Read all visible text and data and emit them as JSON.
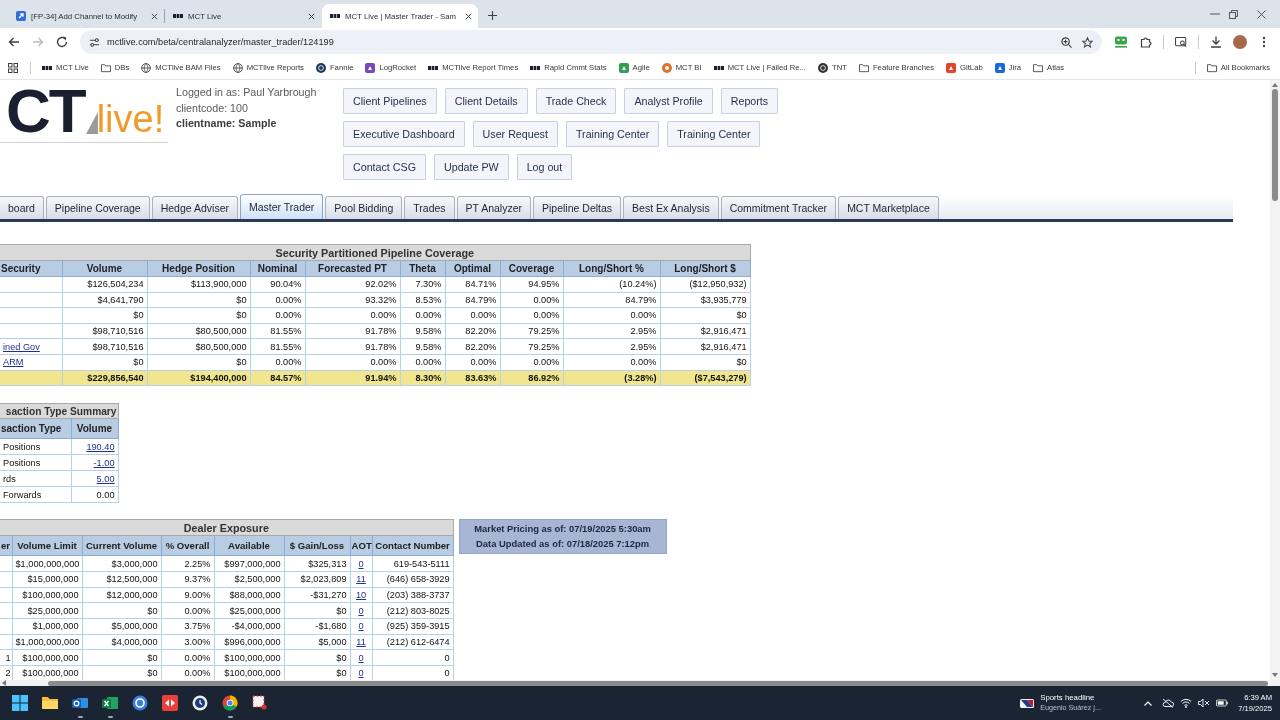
{
  "browser": {
    "tabs": [
      {
        "title": "[FP-34] Add Channel to Modify",
        "selected": false,
        "kind": "tracker"
      },
      {
        "title": "MCT Live",
        "selected": false,
        "kind": "site"
      },
      {
        "title": "MCT Live | Master Trader - Sam",
        "selected": true,
        "kind": "site"
      }
    ],
    "navigation": {
      "back_disabled": false,
      "forward_disabled": true
    },
    "address": "mctlive.com/beta/centralanalyzer/master_trader/124199",
    "bookmarks": [
      {
        "label": "MCT Live",
        "kind": "site"
      },
      {
        "label": "DBs",
        "kind": "folder"
      },
      {
        "label": "MCTlive BAM Files",
        "kind": "globe"
      },
      {
        "label": "MCTlive Reports",
        "kind": "globe"
      },
      {
        "label": "Fannie",
        "kind": "dot",
        "color": "#1e3a5f"
      },
      {
        "label": "LogRocket",
        "kind": "tile",
        "color": "#764abc"
      },
      {
        "label": "MCTlive Report Times",
        "kind": "site"
      },
      {
        "label": "Rapid Cmmt Stats",
        "kind": "site"
      },
      {
        "label": "Agile",
        "kind": "tile",
        "color": "#2e9e4f"
      },
      {
        "label": "MCT BI",
        "kind": "ring",
        "color": "#e0702a"
      },
      {
        "label": "MCT Live | Failed Re...",
        "kind": "site"
      },
      {
        "label": "TNT",
        "kind": "dot",
        "color": "#333333"
      },
      {
        "label": "Feature Branches",
        "kind": "folder"
      },
      {
        "label": "GitLab",
        "kind": "tile",
        "color": "#e24329"
      },
      {
        "label": "Jira",
        "kind": "tile",
        "color": "#1868db"
      },
      {
        "label": "Atlas",
        "kind": "folder"
      }
    ],
    "all_bookmarks": "All Bookmarks"
  },
  "page": {
    "logo": {
      "mark": "CT",
      "word": "live!"
    },
    "session": {
      "logged_in_as": "Logged in as: Paul Yarbrough",
      "clientcode": "clientcode: 100",
      "clientname": "clientname: Sample"
    },
    "menu_rows": [
      [
        "Client Pipelines",
        "Client Details",
        "Trade Check",
        "Analyst Profile",
        "Reports"
      ],
      [
        "Executive Dashboard",
        "User Request",
        "Training Center",
        "Training Center"
      ],
      [
        "Contact CSG",
        "Update PW",
        "Log out"
      ]
    ],
    "nav_tabs": [
      {
        "label": "board",
        "selected": false
      },
      {
        "label": "Pipeline Coverage",
        "selected": false
      },
      {
        "label": "Hedge Adviser",
        "selected": false
      },
      {
        "label": "Master Trader",
        "selected": true
      },
      {
        "label": "Pool Bidding",
        "selected": false
      },
      {
        "label": "Trades",
        "selected": false
      },
      {
        "label": "PT Analyzer",
        "selected": false
      },
      {
        "label": "Pipeline Deltas",
        "selected": false
      },
      {
        "label": "Best Ex Analysis",
        "selected": false
      },
      {
        "label": "Commitment Tracker",
        "selected": false
      },
      {
        "label": "MCT Marketplace",
        "selected": false
      }
    ],
    "security_coverage": {
      "title": "Security Partitioned Pipeline Coverage",
      "columns": [
        "Security",
        "Volume",
        "Hedge Position",
        "Nominal",
        "Forecasted PT",
        "Theta",
        "Optimal",
        "Coverage",
        "Long/Short %",
        "Long/Short $"
      ],
      "rows": [
        {
          "values": [
            "$126,504,234",
            "$113,900,000",
            "90.04%",
            "92.02%",
            "7.30%",
            "84.71%",
            "94.95%",
            "(10.24%)",
            "($12,950,932)"
          ]
        },
        {
          "values": [
            "$4,641,790",
            "$0",
            "0.00%",
            "93.32%",
            "8.53%",
            "84.79%",
            "0.00%",
            "84.79%",
            "$3,935,779"
          ]
        },
        {
          "values": [
            "$0",
            "$0",
            "0.00%",
            "0.00%",
            "0.00%",
            "0.00%",
            "0.00%",
            "0.00%",
            "$0"
          ]
        },
        {
          "values": [
            "$98,710,516",
            "$80,500,000",
            "81.55%",
            "91.78%",
            "9.58%",
            "82.20%",
            "79.25%",
            "2.95%",
            "$2,916,471"
          ]
        },
        {
          "security": "ined Gov",
          "link": true,
          "values": [
            "$98,710,516",
            "$80,500,000",
            "81.55%",
            "91.78%",
            "9.58%",
            "82.20%",
            "79.25%",
            "2.95%",
            "$2,916,471"
          ]
        },
        {
          "security": "ARM",
          "link": true,
          "values": [
            "$0",
            "$0",
            "0.00%",
            "0.00%",
            "0.00%",
            "0.00%",
            "0.00%",
            "0.00%",
            "$0"
          ]
        }
      ],
      "total": {
        "values": [
          "$229,856,540",
          "$194,400,000",
          "84.57%",
          "91.94%",
          "8.30%",
          "83.63%",
          "86.92%",
          "(3.28%)",
          "($7,543,279)"
        ]
      }
    },
    "transaction_summary": {
      "title": "saction Type Summary",
      "columns": [
        "saction Type",
        "Volume"
      ],
      "rows": [
        {
          "type": "Positions",
          "volume": "190.40",
          "link": true
        },
        {
          "type": "Positions",
          "volume": "-1.00",
          "link": true
        },
        {
          "type": "rds",
          "volume": "5.00",
          "link": true
        },
        {
          "type": "Forwards",
          "volume": "0.00",
          "link": false
        }
      ]
    },
    "dealer_exposure": {
      "title": "Dealer Exposure",
      "columns": [
        {
          "label": "er",
          "link": false
        },
        {
          "label": "Volume Limit",
          "link": false
        },
        {
          "label": "Current Volume",
          "link": false
        },
        {
          "label": "% Overall",
          "link": false
        },
        {
          "label": "Available",
          "link": false
        },
        {
          "label": "$ Gain/Loss",
          "link": false
        },
        {
          "label": "AOT",
          "link": true
        },
        {
          "label": "Contact Number",
          "link": false
        }
      ],
      "rows": [
        {
          "values": [
            "$1,000,000,000",
            "$3,000,000",
            "2.25%",
            "$997,000,000",
            "$325,313",
            "0",
            "619-543-5111"
          ]
        },
        {
          "values": [
            "$15,000,000",
            "$12,500,000",
            "9.37%",
            "$2,500,000",
            "$2,023,809",
            "11",
            "(646) 658-3929"
          ]
        },
        {
          "values": [
            "$100,000,000",
            "$12,000,000",
            "9.00%",
            "$88,000,000",
            "-$31,270",
            "10",
            "(203) 388-3737"
          ]
        },
        {
          "values": [
            "$25,000,000",
            "$0",
            "0.00%",
            "$25,000,000",
            "$0",
            "0",
            "(212) 803-8025"
          ]
        },
        {
          "values": [
            "$1,000,000",
            "$5,000,000",
            "3.75%",
            "-$4,000,000",
            "-$1,680",
            "0",
            "(925) 359-3915"
          ]
        },
        {
          "values": [
            "$1,000,000,000",
            "$4,000,000",
            "3.00%",
            "$996,000,000",
            "$5,000",
            "11",
            "(212) 612-6474"
          ]
        },
        {
          "dealer": "1",
          "values": [
            "$100,000,000",
            "$0",
            "0.00%",
            "$100,000,000",
            "$0",
            "0",
            "0"
          ]
        },
        {
          "dealer": "2",
          "values": [
            "$100,000,000",
            "$0",
            "0.00%",
            "$100,000,000",
            "$0",
            "0",
            "0"
          ]
        }
      ]
    },
    "market_info": [
      "Market Pricing as of: 07/19/2025 5:30am",
      "Data Updated as of: 07/18/2025 7:12pm"
    ]
  },
  "taskbar": {
    "apps": [
      {
        "kind": "start",
        "running": false
      },
      {
        "kind": "files",
        "running": false
      },
      {
        "kind": "mail",
        "running": true
      },
      {
        "kind": "sheet",
        "running": true
      },
      {
        "kind": "disc",
        "running": false
      },
      {
        "kind": "arrows",
        "running": false
      },
      {
        "kind": "clock",
        "running": false
      },
      {
        "kind": "browser",
        "running": true
      },
      {
        "kind": "snip",
        "running": false
      }
    ],
    "news": {
      "headline": "Sports headline",
      "detail": "Eugenio Suárez j..."
    },
    "volume_muted": true,
    "time": "6:39 AM",
    "date": "7/19/2025"
  }
}
